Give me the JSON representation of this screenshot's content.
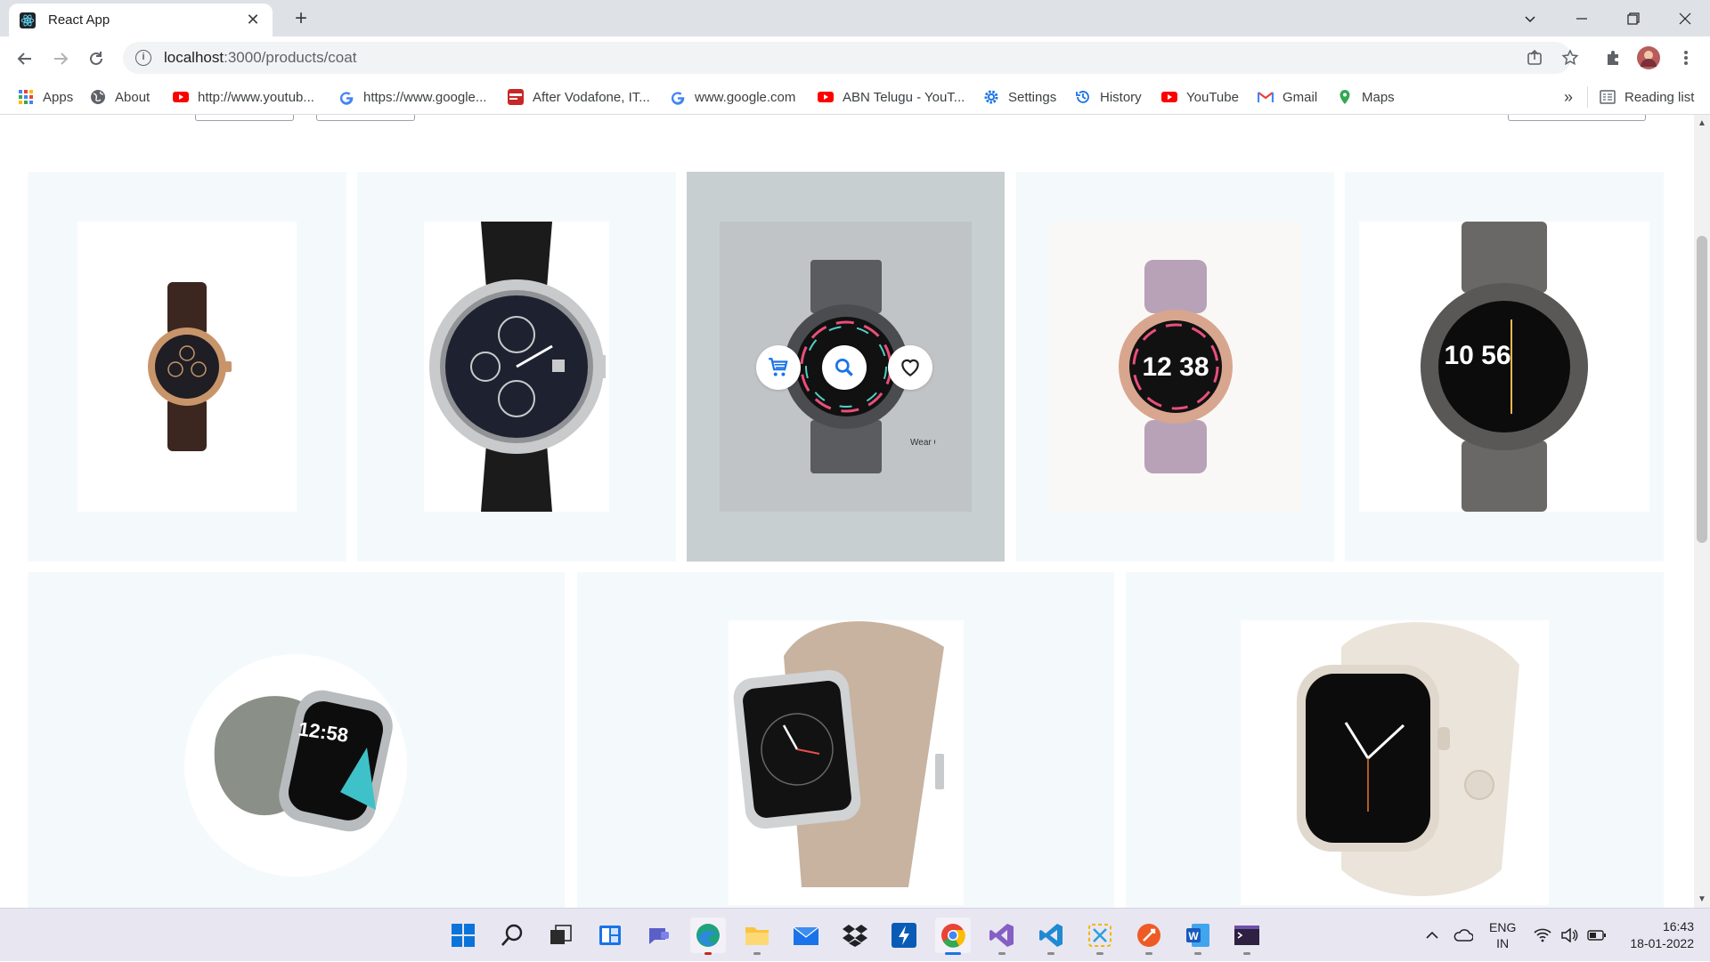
{
  "browser": {
    "tab_title": "React App",
    "new_tab_symbol": "+",
    "url_host": "localhost",
    "url_rest": ":3000/products/coat"
  },
  "bookmarks": [
    {
      "label": "Apps",
      "icon": "apps-grid-icon",
      "color": "#4285f4"
    },
    {
      "label": "About",
      "icon": "globe-icon",
      "color": "#5f6368"
    },
    {
      "label": "http://www.youtub...",
      "icon": "youtube-icon",
      "color": "#ff0000"
    },
    {
      "label": "https://www.google...",
      "icon": "google-icon",
      "color": "#4285f4"
    },
    {
      "label": "After Vodafone, IT...",
      "icon": "news-icon",
      "color": "#c62828"
    },
    {
      "label": "www.google.com",
      "icon": "google-icon",
      "color": "#4285f4"
    },
    {
      "label": "ABN Telugu - YouT...",
      "icon": "youtube-icon",
      "color": "#ff0000"
    },
    {
      "label": "Settings",
      "icon": "gear-icon",
      "color": "#1a73e8"
    },
    {
      "label": "History",
      "icon": "history-icon",
      "color": "#1a73e8"
    },
    {
      "label": "YouTube",
      "icon": "youtube-icon",
      "color": "#ff0000"
    },
    {
      "label": "Gmail",
      "icon": "gmail-icon",
      "color": "#ea4335"
    },
    {
      "label": "Maps",
      "icon": "maps-pin-icon",
      "color": "#34a853"
    }
  ],
  "bookmarks_overflow": "»",
  "reading_list": "Reading list",
  "products": {
    "row1": [
      {
        "name": "product-lg-watch-urbane-gold",
        "watch_time": ""
      },
      {
        "name": "product-lg-watch-urbane-silver",
        "watch_time": ""
      },
      {
        "name": "product-fossil-gen6-smoke",
        "watch_time": ""
      },
      {
        "name": "product-fossil-gen6-rose",
        "watch_time": "12 38"
      },
      {
        "name": "product-fossil-gen5e-gunmetal",
        "watch_time": "10 56"
      }
    ],
    "row2": [
      {
        "name": "product-fitbit-sense",
        "watch_time": "12:58"
      },
      {
        "name": "product-square-smartwatch-beige",
        "watch_time": ""
      },
      {
        "name": "product-apple-watch-starlight",
        "watch_time": ""
      }
    ],
    "hover_actions": [
      "cart-icon",
      "search-icon",
      "heart-icon"
    ]
  },
  "taskbar": {
    "lang_top": "ENG",
    "lang_bottom": "IN",
    "time": "16:43",
    "date": "18-01-2022"
  },
  "colors": {
    "card_bg": "#f4f9fc",
    "card_hover_bg": "#c7cfd1",
    "accent_blue": "#1a73e8"
  }
}
